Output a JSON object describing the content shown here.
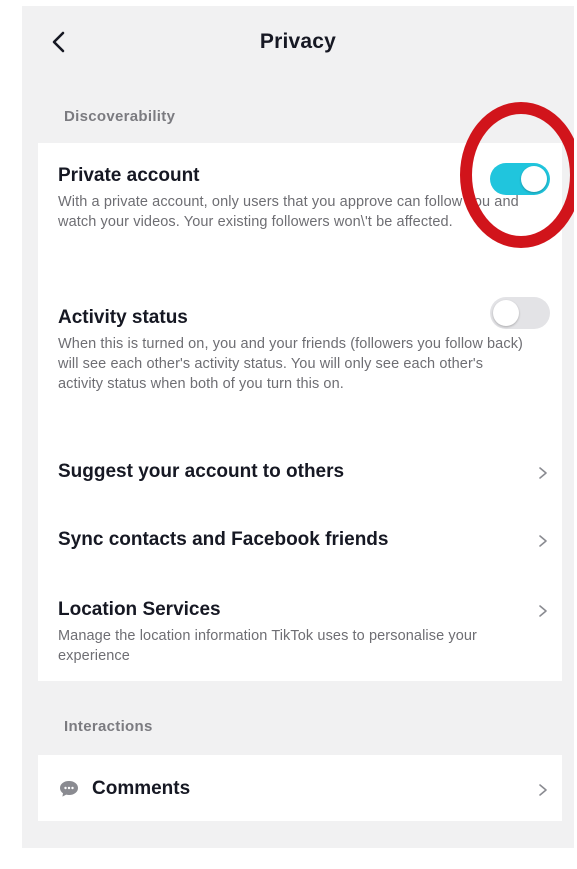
{
  "header": {
    "title": "Privacy"
  },
  "sections": {
    "discoverability": "Discoverability",
    "interactions": "Interactions"
  },
  "private_account": {
    "title": "Private account",
    "description": "With a private account, only users that you approve can follow you and watch your videos. Your existing followers won\\'t be affected.",
    "enabled": true
  },
  "activity_status": {
    "title": "Activity status",
    "description": "When this is turned on, you and your friends (followers you follow back) will see each other's activity status. You will only see each other's activity status when both of you turn this on.",
    "enabled": false
  },
  "suggest_account": {
    "title": "Suggest your account to others"
  },
  "sync_contacts": {
    "title": "Sync contacts and Facebook friends"
  },
  "location_services": {
    "title": "Location Services",
    "description": "Manage the location information TikTok uses to personalise your experience"
  },
  "comments": {
    "title": "Comments"
  },
  "colors": {
    "toggle_on": "#20c5dd",
    "toggle_off": "#e3e3e6",
    "highlight": "#d1141b",
    "background": "#f1f1f2"
  },
  "icons": {
    "back": "chevron-left-icon",
    "row_arrow": "chevron-right-icon",
    "comments": "speech-bubble-icon"
  }
}
